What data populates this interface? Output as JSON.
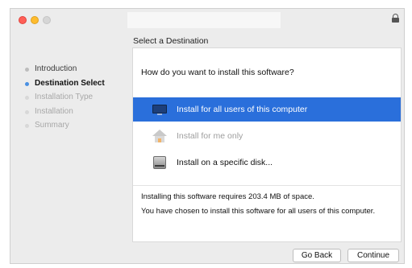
{
  "window": {
    "section_title": "Select a Destination"
  },
  "sidebar": {
    "steps": [
      {
        "label": "Introduction",
        "state": "done"
      },
      {
        "label": "Destination Select",
        "state": "current"
      },
      {
        "label": "Installation Type",
        "state": "future"
      },
      {
        "label": "Installation",
        "state": "future"
      },
      {
        "label": "Summary",
        "state": "future"
      }
    ]
  },
  "content": {
    "question": "How do you want to install this software?",
    "options": [
      {
        "label": "Install for all users of this computer",
        "icon": "computer-icon",
        "selected": true,
        "enabled": true
      },
      {
        "label": "Install for me only",
        "icon": "home-icon",
        "selected": false,
        "enabled": false
      },
      {
        "label": "Install on a specific disk...",
        "icon": "disk-icon",
        "selected": false,
        "enabled": true
      }
    ],
    "space_required": "Installing this software requires 203.4 MB of space.",
    "choice_summary": "You have chosen to install this software for all users of this computer."
  },
  "buttons": {
    "back": "Go Back",
    "continue": "Continue"
  },
  "colors": {
    "selection": "#2a6fdb",
    "current_step_dot": "#4a90e2"
  }
}
